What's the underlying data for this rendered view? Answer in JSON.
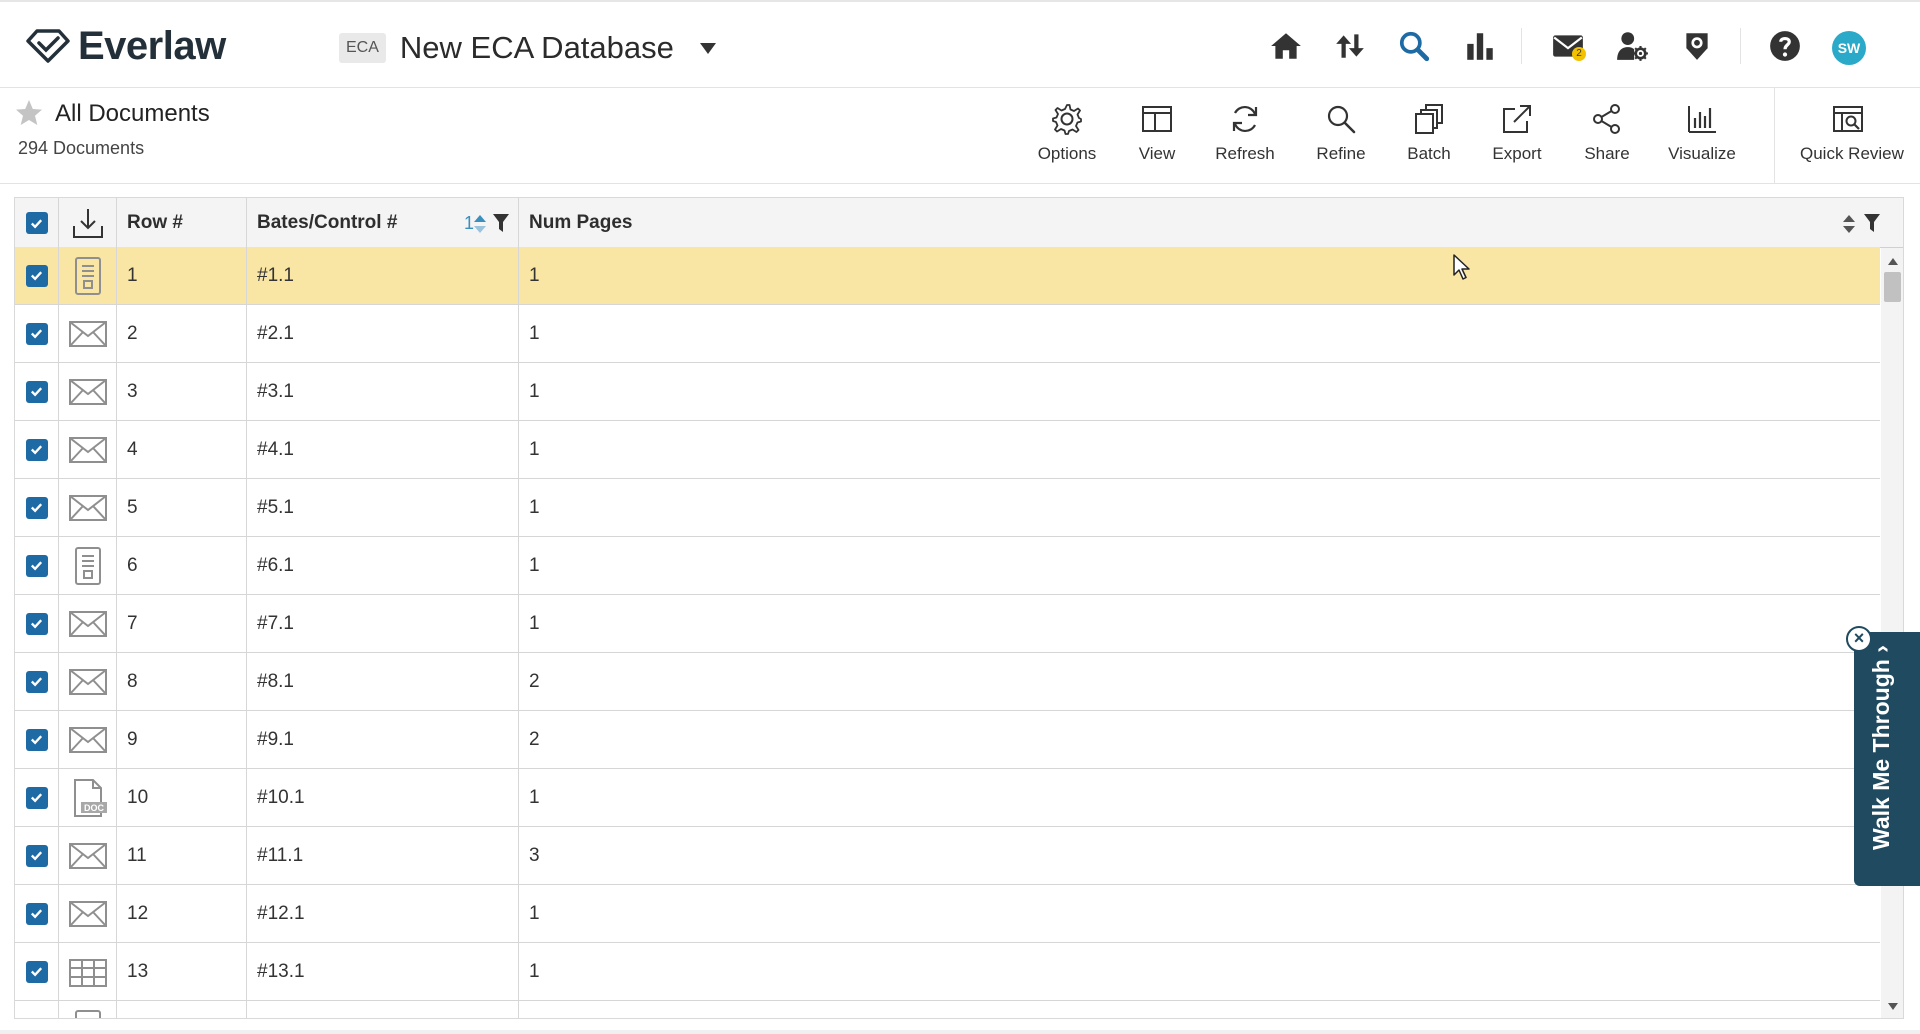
{
  "app": {
    "logo_text": "Everlaw"
  },
  "database": {
    "badge": "ECA",
    "name": "New ECA Database"
  },
  "nav": {
    "mail_badge_count": "2",
    "avatar_initials": "SW"
  },
  "page": {
    "title": "All Documents",
    "doc_count": "294 Documents"
  },
  "toolbar": {
    "options": "Options",
    "view": "View",
    "refresh": "Refresh",
    "refine": "Refine",
    "batch": "Batch",
    "export": "Export",
    "share": "Share",
    "visualize": "Visualize",
    "quick_review": "Quick Review"
  },
  "grid": {
    "columns": {
      "row": "Row #",
      "bates": "Bates/Control #",
      "sort_priority": "1",
      "pages": "Num Pages"
    },
    "rows": [
      {
        "row": "1",
        "bates": "#1.1",
        "pages": "1",
        "type": "doc-icon"
      },
      {
        "row": "2",
        "bates": "#2.1",
        "pages": "1",
        "type": "email-icon"
      },
      {
        "row": "3",
        "bates": "#3.1",
        "pages": "1",
        "type": "email-icon"
      },
      {
        "row": "4",
        "bates": "#4.1",
        "pages": "1",
        "type": "email-icon"
      },
      {
        "row": "5",
        "bates": "#5.1",
        "pages": "1",
        "type": "email-icon"
      },
      {
        "row": "6",
        "bates": "#6.1",
        "pages": "1",
        "type": "doc-icon"
      },
      {
        "row": "7",
        "bates": "#7.1",
        "pages": "1",
        "type": "email-icon"
      },
      {
        "row": "8",
        "bates": "#8.1",
        "pages": "2",
        "type": "email-icon"
      },
      {
        "row": "9",
        "bates": "#9.1",
        "pages": "2",
        "type": "email-icon"
      },
      {
        "row": "10",
        "bates": "#10.1",
        "pages": "1",
        "type": "word-doc-icon"
      },
      {
        "row": "11",
        "bates": "#11.1",
        "pages": "3",
        "type": "email-icon"
      },
      {
        "row": "12",
        "bates": "#12.1",
        "pages": "1",
        "type": "email-icon"
      },
      {
        "row": "13",
        "bates": "#13.1",
        "pages": "1",
        "type": "spreadsheet-icon"
      }
    ]
  },
  "walkthrough": {
    "label": "Walk Me Through",
    "close": "×"
  },
  "colors": {
    "accent": "#1d6aa5",
    "highlight_row": "#f9e6a4",
    "walkthrough_bg": "#1f4a5f",
    "search_active": "#1d6aa5"
  }
}
